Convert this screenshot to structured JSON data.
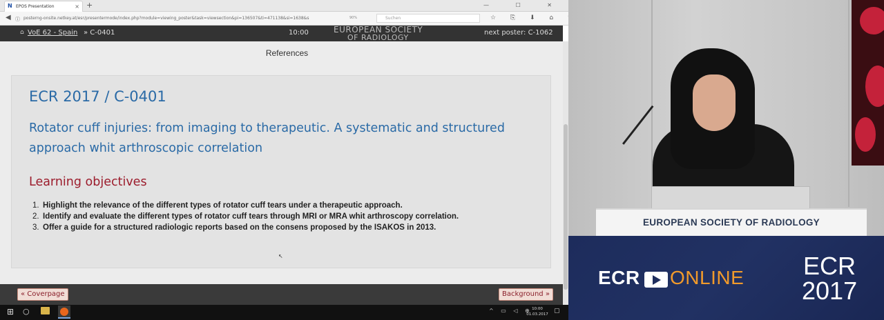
{
  "browser": {
    "tab_title": "EPOS Presentation",
    "tab_favicon": "N",
    "tab_close": "×",
    "new_tab": "+",
    "window_controls": "—  ☐  ✕",
    "url": "posterng-onsite.netkey.at/esr/presentermode/index.php?module=viewing_poster&task=viewsection&pi=136507&ti=471138&si=1638&s",
    "zoom": "90%",
    "search_placeholder": "Suchen",
    "toolbar_icons": "☆ ⎘ ⬇ ⌂ ♥ ≡"
  },
  "poster_header": {
    "breadcrumb_1": "VoE 62 - Spain",
    "breadcrumb_2": "» C-0401",
    "timer": "10:00",
    "logo_line1": "EUROPEAN SOCIETY",
    "logo_line2": "OF RADIOLOGY",
    "next_poster": "next poster: C-1062"
  },
  "section_title": "References",
  "card": {
    "code": "ECR 2017 / C-0401",
    "title": "Rotator cuff injuries: from imaging to therapeutic. A systematic and structured approach whit arthroscopic correlation",
    "heading": "Learning objectives",
    "objectives": [
      "Highlight  the relevance of the different types  of rotator cuff tears under a therapeutic approach.",
      "Identify and evaluate the different types of rotator cuff  tears through MRI  or MRA whit arthroscopy correlation.",
      "Offer a guide for a  structured radiologic reports based on the consens proposed by the ISAKOS in 2013."
    ]
  },
  "footer": {
    "prev_label": "« Coverpage",
    "next_label": "Background »"
  },
  "taskbar": {
    "time": "10:00",
    "date": "01.03.2017"
  },
  "video": {
    "podium_text": "EUROPEAN SOCIETY OF RADIOLOGY"
  },
  "brand": {
    "ecr": "ECR",
    "online": "ONLINE",
    "big_line1": "ECR",
    "big_line2": "2017"
  },
  "colors": {
    "title_blue": "#2a6aa6",
    "heading_red": "#9c1c2c",
    "brand_navy": "#1d2c5c",
    "brand_orange": "#f19a2b"
  }
}
